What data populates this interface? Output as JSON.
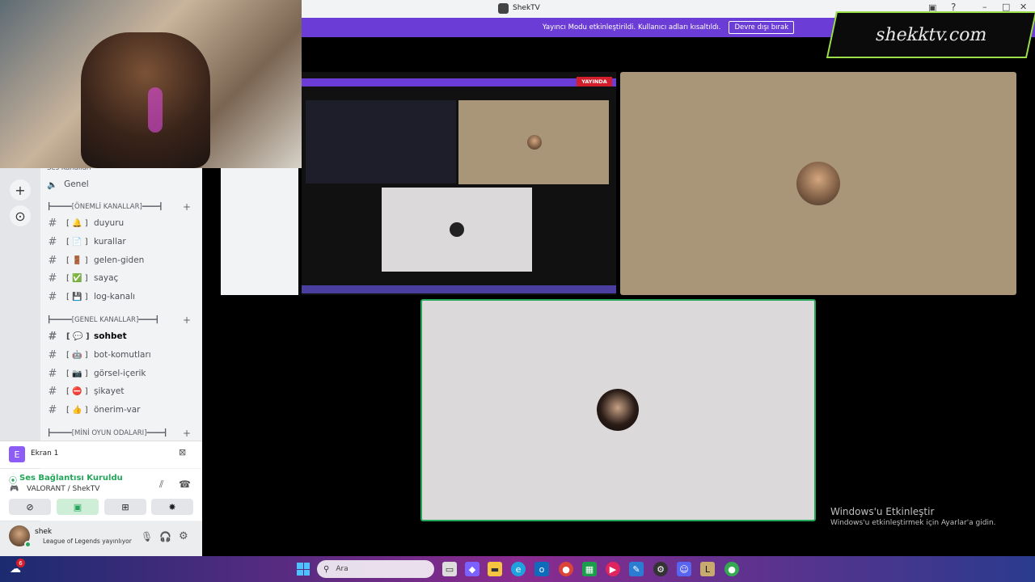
{
  "window": {
    "title": "ShekTV"
  },
  "banner": {
    "text": "Yayıncı Modu etkinleştirildi. Kullanıcı adları kısaltıldı.",
    "button": "Devre dışı bırak"
  },
  "sidebar": {
    "voice_category": "Ses Kanalları",
    "voice_channel": "Genel",
    "categories": [
      {
        "label": "┣━━━━━[ÖNEMLİ KANALLAR]━━━━┫",
        "channels": [
          {
            "emoji": "[ 🔔 ]",
            "name": "duyuru"
          },
          {
            "emoji": "[ 📄 ]",
            "name": "kurallar"
          },
          {
            "emoji": "[ 🚪 ]",
            "name": "gelen-giden"
          },
          {
            "emoji": "[ ✅ ]",
            "name": "sayaç"
          },
          {
            "emoji": "[ 💾 ]",
            "name": "log-kanalı"
          }
        ]
      },
      {
        "label": "┣━━━━━[GENEL KANALLAR]━━━━┫",
        "channels": [
          {
            "emoji": "[ 💬 ]",
            "name": "sohbet"
          },
          {
            "emoji": "[ 🤖 ]",
            "name": "bot-komutları"
          },
          {
            "emoji": "[ 📷 ]",
            "name": "görsel-içerik"
          },
          {
            "emoji": "[ ⛔ ]",
            "name": "şikayet"
          },
          {
            "emoji": "[ 👍 ]",
            "name": "önerim-var"
          }
        ]
      },
      {
        "label": "┣━━━━━[MİNİ OYUN ODALARI]━━━━┫",
        "channels": []
      }
    ]
  },
  "screen_panel": {
    "label": "Ekran 1"
  },
  "voice_panel": {
    "status": "Ses Bağlantısı Kuruldu",
    "channel": "VALORANT / ShekTV"
  },
  "user_panel": {
    "name": "shek",
    "activity": "League of Legends yayınlıyor"
  },
  "activation": {
    "title": "Windows'u Etkinleştir",
    "subtitle": "Windows'u etkinleştirmek için Ayarlar'a gidin."
  },
  "taskbar": {
    "search_placeholder": "Ara",
    "notification_count": "6"
  },
  "overlay": {
    "logo_text": "shekktv.com"
  },
  "nested_stream": {
    "live_badge": "YAYINDA"
  },
  "colors": {
    "accent": "#6c3cd7",
    "voice_green": "#23a55a",
    "tile_bg": "#a99577"
  }
}
